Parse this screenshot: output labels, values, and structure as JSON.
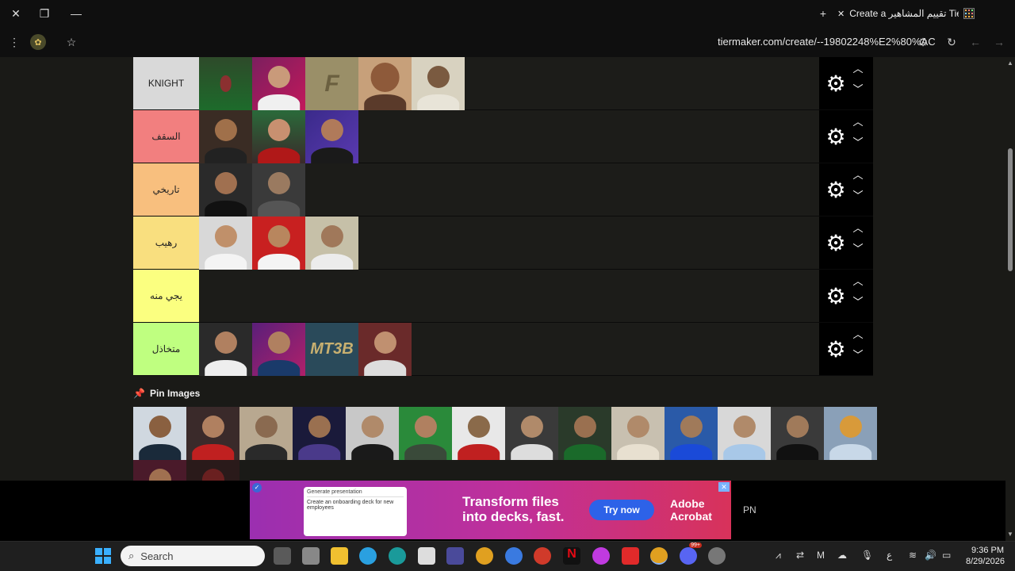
{
  "browser": {
    "tab_title": "Create a تقييم المشاهير Tier List",
    "url": "tiermaker.com/create/--19802248%E2%80%AC"
  },
  "tiers": [
    {
      "label": "KNIGHT",
      "color": "#d9d9d9",
      "images": 5
    },
    {
      "label": "السقف",
      "color": "#f27f7f",
      "images": 3
    },
    {
      "label": "تاريخي",
      "color": "#f8bf7e",
      "images": 2
    },
    {
      "label": "رهيب",
      "color": "#f9df7f",
      "images": 3
    },
    {
      "label": "يجي منه",
      "color": "#fbff80",
      "images": 0
    },
    {
      "label": "متخاذل",
      "color": "#bfff80",
      "images": 4
    }
  ],
  "controls": {
    "settings_icon": "gear-icon",
    "up_icon": "chevron-up-icon",
    "down_icon": "chevron-down-icon"
  },
  "pin_images": {
    "label": "Pin Images",
    "row1_count": 14,
    "row2_count": 2
  },
  "ad": {
    "card_title": "Generate presentation",
    "card_text": "Create an onboarding deck for new employees",
    "headline_1": "Transform files",
    "headline_2": "into decks, fast.",
    "button": "Try now",
    "brand_1": "Adobe",
    "brand_2": "Acrobat",
    "side_text": "PN"
  },
  "taskbar": {
    "search_placeholder": "Search",
    "time": "9:36 PM",
    "date": "8/29/2026",
    "badge": "99+"
  }
}
